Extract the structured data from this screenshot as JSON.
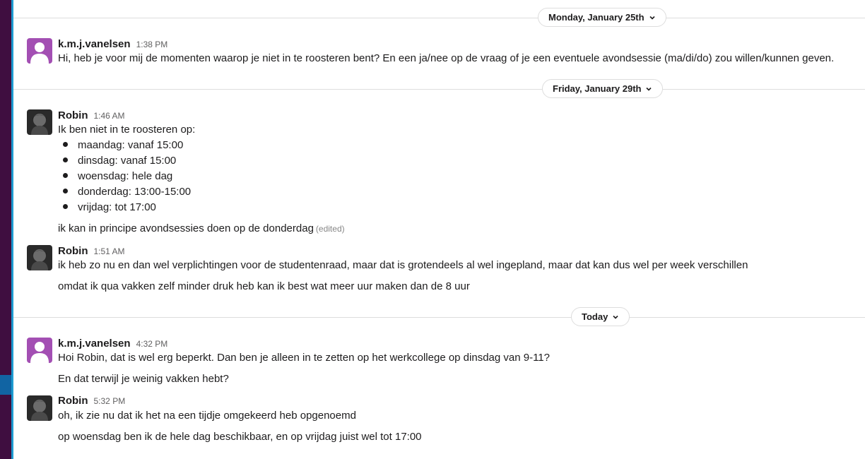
{
  "dividers": [
    {
      "label": "Monday, January 25th"
    },
    {
      "label": "Friday, January 29th"
    },
    {
      "label": "Today"
    }
  ],
  "colors": {
    "sidebar": "#3f0e40",
    "sidebar_active": "#1164a3",
    "channel_border": "#1d9bd1",
    "default_avatar": "#a34fb3"
  },
  "messages": [
    {
      "author": "k.m.j.vanelsen",
      "time": "1:38 PM",
      "avatar": "default-user-icon",
      "text": "Hi, heb je voor mij de momenten waarop je niet in te roosteren bent? En een ja/nee op de vraag of je een eventuele avondsessie (ma/di/do) zou willen/kunnen geven."
    },
    {
      "author": "Robin",
      "time": "1:46 AM",
      "avatar": "photo",
      "intro": "Ik ben niet in te roosteren op:",
      "bullets": [
        "maandag: vanaf 15:00",
        "dinsdag: vanaf 15:00",
        "woensdag: hele dag",
        "donderdag: 13:00-15:00",
        "vrijdag: tot 17:00"
      ],
      "followup": "ik kan in principe avondsessies doen op de donderdag",
      "edited": "(edited)"
    },
    {
      "author": "Robin",
      "time": "1:51 AM",
      "avatar": "photo",
      "lines": [
        "ik heb zo nu en dan wel verplichtingen voor de studentenraad, maar dat is grotendeels al wel ingepland, maar dat kan dus wel per week verschillen",
        "omdat ik qua vakken zelf minder druk heb kan ik best wat meer uur maken dan de 8 uur"
      ]
    },
    {
      "author": "k.m.j.vanelsen",
      "time": "4:32 PM",
      "avatar": "default-user-icon",
      "lines": [
        "Hoi Robin, dat is wel erg beperkt. Dan ben je alleen in te zetten op het werkcollege op dinsdag van 9-11?",
        "En dat terwijl je weinig vakken hebt?"
      ]
    },
    {
      "author": "Robin",
      "time": "5:32 PM",
      "avatar": "photo",
      "lines": [
        "oh, ik zie nu dat ik het na een tijdje omgekeerd heb opgenoemd",
        "op woensdag ben ik de hele dag beschikbaar, en op vrijdag juist wel tot 17:00"
      ]
    }
  ]
}
